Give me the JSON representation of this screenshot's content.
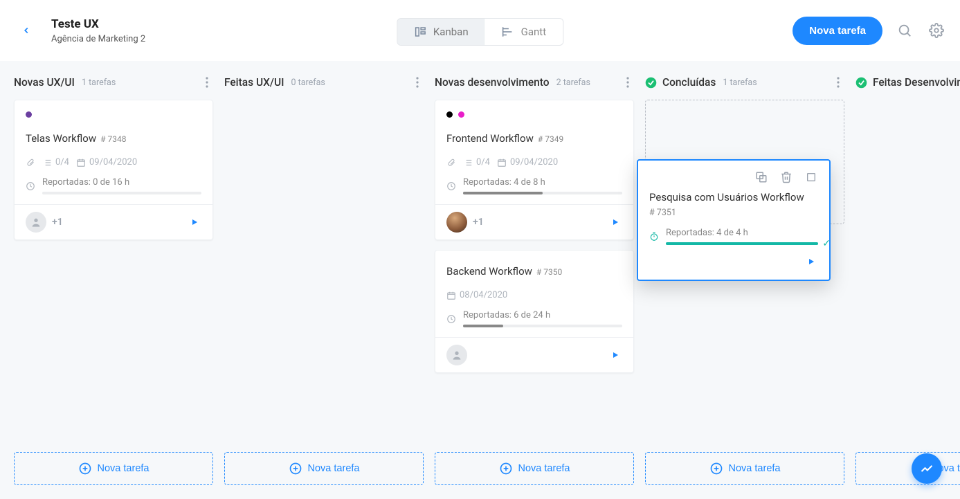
{
  "header": {
    "title": "Teste UX",
    "subtitle": "Agência de Marketing 2",
    "kanban": "Kanban",
    "gantt": "Gantt",
    "new_task": "Nova tarefa"
  },
  "columns": {
    "novas_ux": {
      "title": "Novas UX/UI",
      "count": "1 tarefas"
    },
    "feitas_ux": {
      "title": "Feitas UX/UI",
      "count": "0 tarefas"
    },
    "novas_dev": {
      "title": "Novas desenvolvimento",
      "count": "2 tarefas"
    },
    "concluidas": {
      "title": "Concluídas",
      "count": "1 tarefas"
    },
    "feitas_dev": {
      "title": "Feitas Desenvolvim"
    }
  },
  "cards": {
    "telas": {
      "title": "Telas Workflow",
      "id": "# 7348",
      "subtasks": "0/4",
      "date": "09/04/2020",
      "reported": "Reportadas: 0 de 16 h",
      "assignees_extra": "+1",
      "tag_colors": [
        "#6b3fa0"
      ]
    },
    "frontend": {
      "title": "Frontend Workflow",
      "id": "# 7349",
      "subtasks": "0/4",
      "date": "09/04/2020",
      "reported": "Reportadas: 4 de 8 h",
      "assignees_extra": "+1",
      "tag_colors": [
        "#000000",
        "#e91ec9"
      ]
    },
    "backend": {
      "title": "Backend Workflow",
      "id": "# 7350",
      "date": "08/04/2020",
      "reported": "Reportadas: 6 de 24 h"
    },
    "pesquisa": {
      "title": "Pesquisa com Usuários Workflow",
      "id": "# 7351",
      "reported": "Reportadas: 4 de 4 h"
    }
  },
  "labels": {
    "nova_tarefa_lane": "Nova tarefa"
  }
}
